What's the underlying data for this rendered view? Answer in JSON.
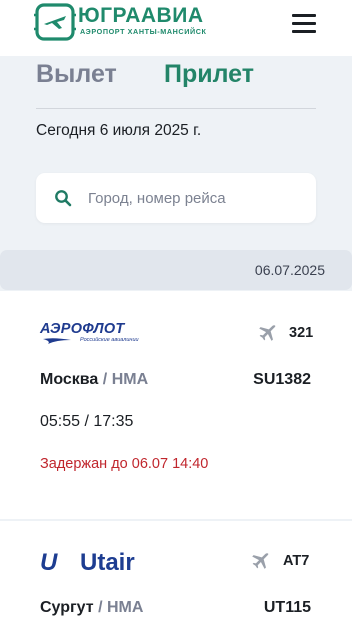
{
  "header": {
    "logo_title": "ЮГРААВИА",
    "logo_subtitle": "АЭРОПОРТ ХАНТЫ-МАНСИЙСК",
    "menu_icon": "hamburger-menu-icon"
  },
  "tabs": [
    {
      "label": "Вылет",
      "active": false
    },
    {
      "label": "Прилет",
      "active": true
    }
  ],
  "today_label": "Сегодня 6 июля 2025 г.",
  "search": {
    "placeholder": "Город, номер рейса",
    "value": "",
    "icon": "search-icon"
  },
  "date_header": "06.07.2025",
  "flights": [
    {
      "airline": "АЭРОФЛОТ",
      "airline_subtitle": "Российские авиалинии",
      "aircraft": "321",
      "origin": "Москва",
      "separator": "/",
      "destination": "HMA",
      "flight_number": "SU1382",
      "times": "05:55 / 17:35",
      "status": "Задержан до 06.07 14:40"
    },
    {
      "airline": "Utair",
      "airline_mark": "U",
      "aircraft": "AT7",
      "origin": "Сургут",
      "separator": "/",
      "destination": "HMA",
      "flight_number": "UT115"
    }
  ],
  "colors": {
    "brand_green": "#1f8a6c",
    "active_tab": "#238468",
    "inactive_tab": "#7a8092",
    "status_delayed": "#c0262d",
    "aeroflot_blue": "#1f3b8f",
    "utair_blue": "#1d3d91",
    "page_bg": "#eef2f6"
  }
}
